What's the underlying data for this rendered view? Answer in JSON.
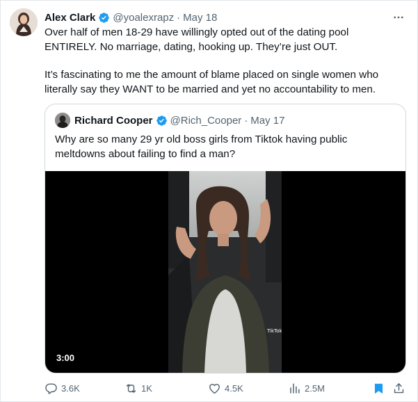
{
  "tweet": {
    "author_name": "Alex Clark",
    "handle": "@yoalexrapz",
    "separator": "·",
    "date": "May 18",
    "paragraph1": "Over half of men 18-29 have willingly opted out of the dating pool ENTIRELY. No marriage, dating, hooking up. They’re just OUT.",
    "paragraph2": "It’s fascinating to me the amount of blame placed on single women who literally say they WANT to be married and yet no accountability to men."
  },
  "quoted": {
    "author_name": "Richard Cooper",
    "handle": "@Rich_Cooper",
    "separator": "·",
    "date": "May 17",
    "text": "Why are so many 29 yr old boss girls from Tiktok having public meltdowns about failing to find a man?",
    "video_duration": "3:00",
    "video_watermark": "TikTok"
  },
  "actions": {
    "replies": "3.6K",
    "retweets": "1K",
    "likes": "4.5K",
    "views": "2.5M"
  },
  "icons": [
    "verified-badge-icon",
    "more-icon",
    "reply-icon",
    "retweet-icon",
    "like-icon",
    "views-icon",
    "bookmark-icon",
    "share-icon"
  ],
  "colors": {
    "verified": "#1d9bf0",
    "bookmark": "#1d9bf0",
    "muted": "#536471",
    "border": "#cfd9de"
  }
}
